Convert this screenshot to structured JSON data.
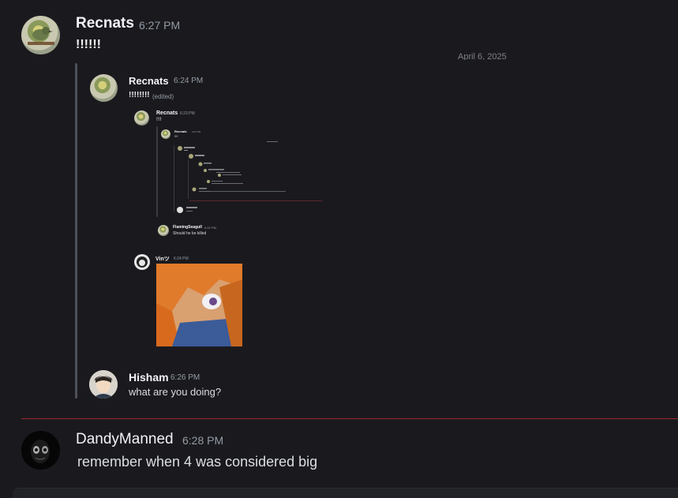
{
  "messages": {
    "m1": {
      "author": "Recnats",
      "time": "6:27 PM",
      "text": "!!!!!!"
    },
    "date_sep": "April 6, 2025",
    "q1": {
      "author": "Recnats",
      "time": "6:24 PM",
      "text": "!!!!!!!!",
      "edited": "(edited)"
    },
    "q2": {
      "author": "Recnats",
      "time": "6:23 PM",
      "text": "!!!!"
    },
    "q3": {
      "author": "Recnats",
      "time": "6:22 PM",
      "text": "!!!!"
    },
    "q4": {
      "author": "FlamingSeagull",
      "time": "6:22 PM",
      "text": "Should he be killed"
    },
    "q5": {
      "author": "Vinツ",
      "time": "6:24 PM"
    },
    "h1": {
      "author": "Hisham",
      "time": "6:26 PM",
      "text": "what are you doing?"
    },
    "d1": {
      "author": "DandyManned",
      "time": "6:28 PM",
      "text": "remember when 4 was considered big"
    }
  },
  "colors": {
    "background": "#1a1a1e",
    "new_divider": "#f23f43",
    "username": "#f2f3f5",
    "timestamp": "#949ba4",
    "text": "#dbdee1"
  }
}
